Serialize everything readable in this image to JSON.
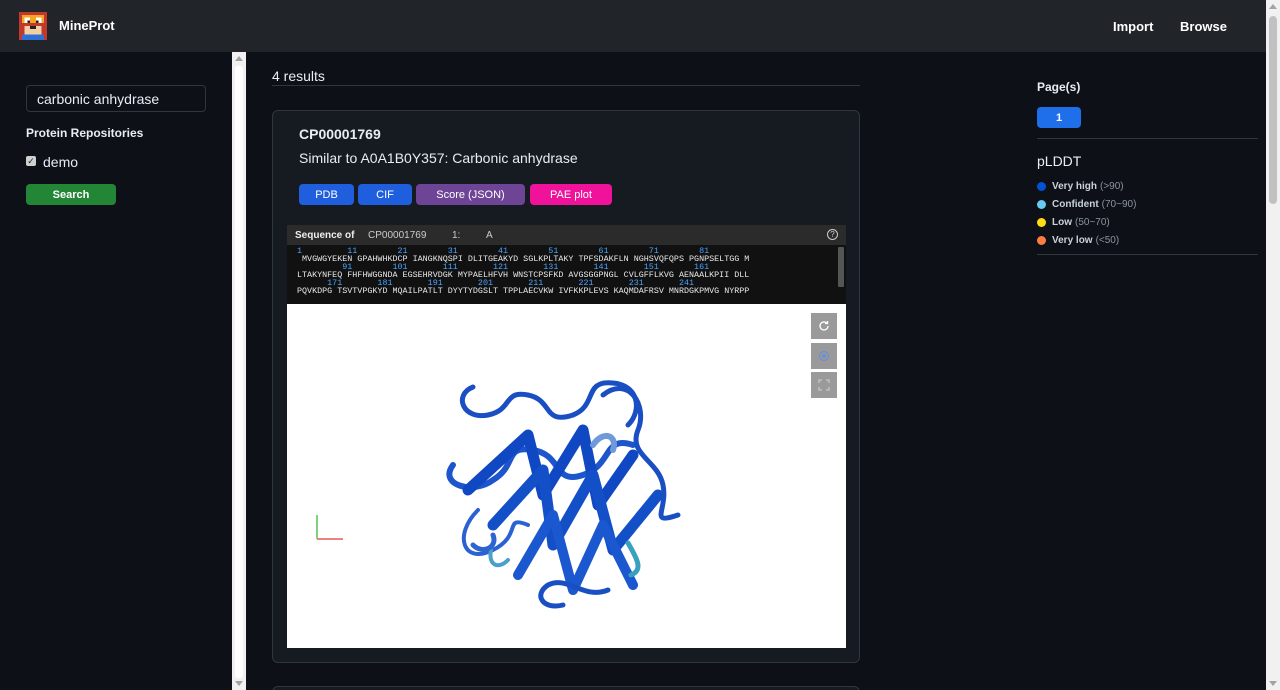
{
  "navbar": {
    "brand": "MineProt",
    "links": [
      "Import",
      "Browse"
    ]
  },
  "sidebar": {
    "search_value": "carbonic anhydrase",
    "repositories_heading": "Protein Repositories",
    "repositories": [
      {
        "label": "demo",
        "checked": true
      }
    ],
    "search_button": "Search"
  },
  "main": {
    "results_count": "4 results",
    "card": {
      "id": "CP00001769",
      "description": "Similar to A0A1B0Y357: Carbonic anhydrase",
      "buttons": [
        {
          "label": "PDB",
          "color": "#1f5fde"
        },
        {
          "label": "CIF",
          "color": "#1f5fde"
        },
        {
          "label": "Score (JSON)",
          "color": "#6e4496"
        },
        {
          "label": "PAE plot",
          "color": "#f0129a"
        }
      ],
      "sequence": {
        "label": "Sequence of",
        "entry": "CP00001769",
        "model": "1:",
        "chain": "A",
        "help": "?",
        "line1_numbers": "1         11        21        31        41        51        61        71        81",
        "line1": " MVGWGYEKEN GPAHWHKDCP IANGKNQSPI DLITGEAKYD SGLKPLTAKY TPFSDAKFLN NGHSVQFQPS PGNPSELTGG M",
        "line2_numbers": "         91        101       111       121       131       141       151       161",
        "line2": "LTAKYNFEQ FHFHWGGNDA EGSEHRVDGK MYPAELHFVH WNSTCPSFKD AVGSGGPNGL CVLGFFLKVG AENAALKPII DLL",
        "line3_numbers": "      171       181       191       201       211       221       231       241",
        "line3": "PQVKDPG TSVTVPGKYD MQAILPATLT DYYTYDGSLT TPPLAECVKW IVFKKPLEVS KAQMDAFRSV MNRDGKPMVG NYRPP"
      },
      "viewer_tools": [
        "reset-icon",
        "focus-icon",
        "fullscreen-icon"
      ]
    }
  },
  "right": {
    "pages_heading": "Page(s)",
    "pages": [
      "1"
    ],
    "plddt_heading": "pLDDT",
    "legend": [
      {
        "name": "Very high",
        "range": "(>90)",
        "color": "#0053d6"
      },
      {
        "name": "Confident",
        "range": "(70~90)",
        "color": "#65cbf3"
      },
      {
        "name": "Low",
        "range": "(50~70)",
        "color": "#ffdb13"
      },
      {
        "name": "Very low",
        "range": "(<50)",
        "color": "#ff7d45"
      }
    ]
  }
}
